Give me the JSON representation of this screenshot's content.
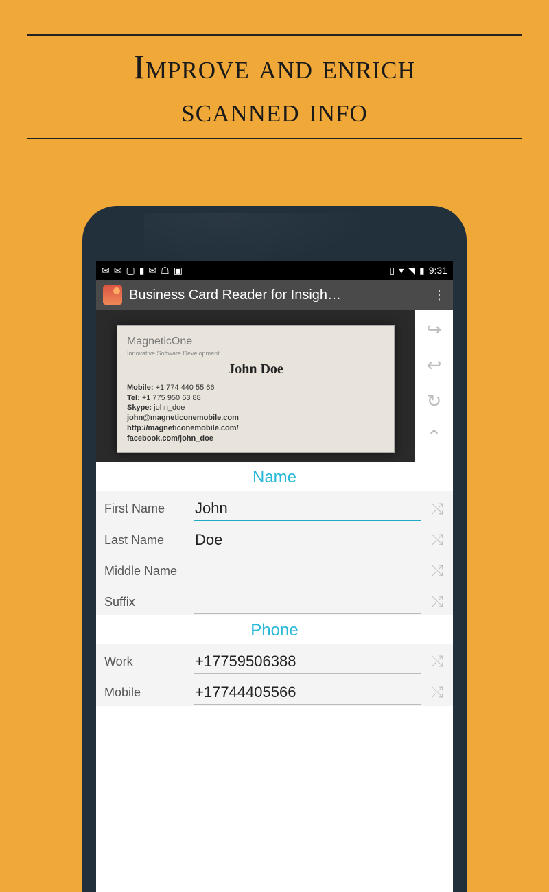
{
  "headline": {
    "line1": "Improve and enrich",
    "line2": "scanned info"
  },
  "status": {
    "time": "9:31"
  },
  "app": {
    "title": "Business Card Reader for Insigh…"
  },
  "card": {
    "brand": "MagneticOne",
    "tagline": "Innovative Software Development",
    "name": "John Doe",
    "mobile_label": "Mobile:",
    "mobile": "+1 774 440 55 66",
    "tel_label": "Tel:",
    "tel": "+1 775 950 63 88",
    "skype_label": "Skype:",
    "skype": "john_doe",
    "email": "john@magneticonemobile.com",
    "url": "http://magneticonemobile.com/",
    "fb": "facebook.com/john_doe"
  },
  "sections": {
    "name": "Name",
    "phone": "Phone"
  },
  "fields": {
    "first_name_label": "First Name",
    "first_name": "John",
    "last_name_label": "Last Name",
    "last_name": "Doe",
    "middle_name_label": "Middle Name",
    "middle_name": "",
    "suffix_label": "Suffix",
    "suffix": "",
    "work_label": "Work",
    "work": "+17759506388",
    "mobile_label": "Mobile",
    "mobile": "+17744405566"
  }
}
